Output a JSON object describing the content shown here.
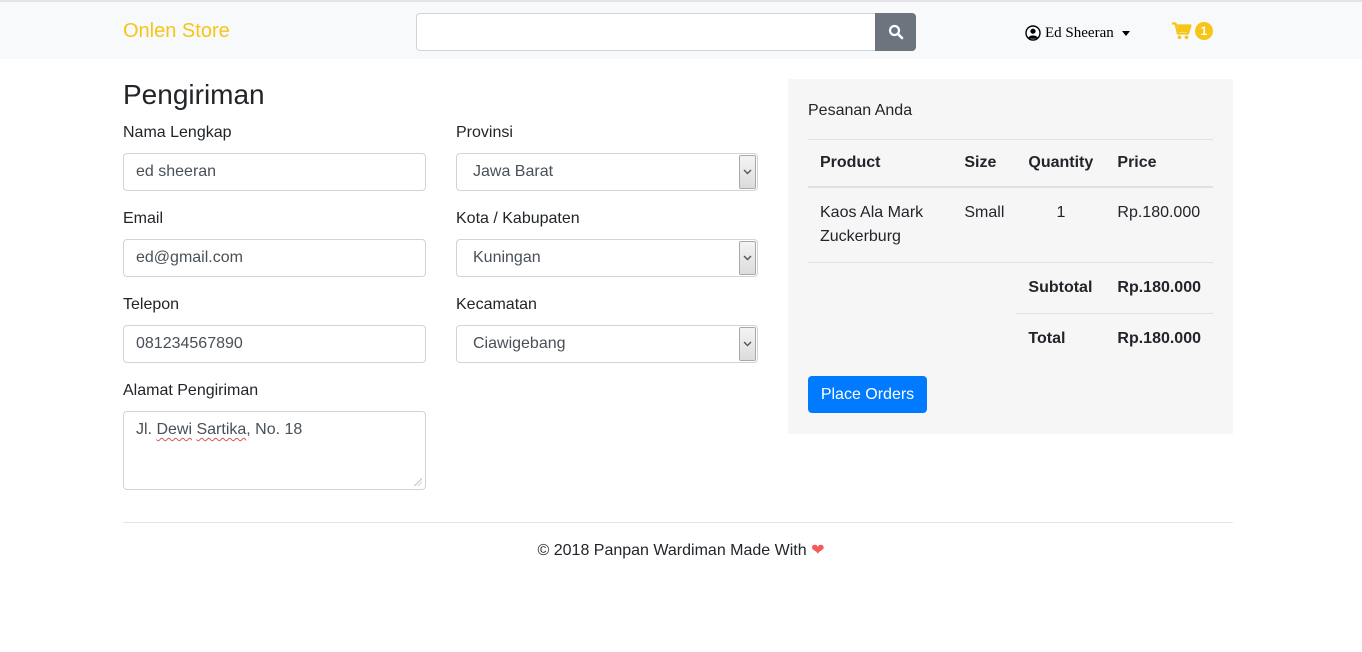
{
  "header": {
    "brand": "Onlen Store",
    "search": {
      "placeholder": "",
      "value": ""
    },
    "user_name": "Ed Sheeran",
    "cart_count": "1"
  },
  "form": {
    "title": "Pengiriman",
    "full_name": {
      "label": "Nama Lengkap",
      "value": "ed sheeran"
    },
    "email": {
      "label": "Email",
      "value": "ed@gmail.com"
    },
    "phone": {
      "label": "Telepon",
      "value": "081234567890"
    },
    "address": {
      "label": "Alamat Pengiriman",
      "value_prefix": "Jl. ",
      "value_word1": "Dewi",
      "value_space": " ",
      "value_word2": "Sartika",
      "value_suffix": ", No. 18"
    },
    "province": {
      "label": "Provinsi",
      "value": "Jawa Barat"
    },
    "city": {
      "label": "Kota / Kabupaten",
      "value": "Kuningan"
    },
    "district": {
      "label": "Kecamatan",
      "value": "Ciawigebang"
    }
  },
  "order": {
    "title": "Pesanan Anda",
    "columns": [
      "Product",
      "Size",
      "Quantity",
      "Price"
    ],
    "items": [
      {
        "product": "Kaos Ala Mark Zuckerburg",
        "size": "Small",
        "quantity": "1",
        "price": "Rp.180.000"
      }
    ],
    "subtotal_label": "Subtotal",
    "subtotal_value": "Rp.180.000",
    "total_label": "Total",
    "total_value": "Rp.180.000",
    "place_order_label": "Place Orders"
  },
  "footer": {
    "text": "© 2018 Panpan Wardiman Made With",
    "heart": "❤"
  },
  "colors": {
    "brand": "#f5c518",
    "primary_button": "#007bff",
    "search_button": "#6c757d",
    "heart": "#f05b5b"
  }
}
